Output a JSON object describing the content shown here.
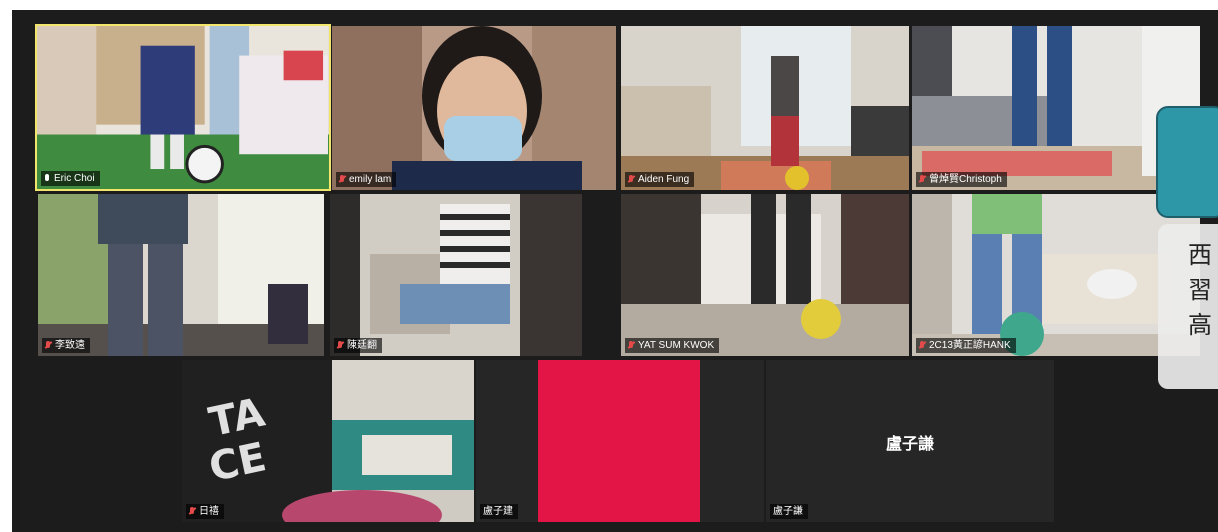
{
  "participants": [
    {
      "name": "Eric Choi",
      "mic": "on",
      "speaking": true
    },
    {
      "name": "emily lam",
      "mic": "muted"
    },
    {
      "name": "Aiden Fung",
      "mic": "muted"
    },
    {
      "name": "曾焯賢Christoph",
      "mic": "muted"
    },
    {
      "name": "李致遠",
      "mic": "muted"
    },
    {
      "name": "陳廷翻",
      "mic": "muted"
    },
    {
      "name": "YAT SUM KWOK",
      "mic": "muted"
    },
    {
      "name": "2C13黃正諺HANK",
      "mic": "muted"
    },
    {
      "name": "日禧",
      "mic": "muted"
    },
    {
      "name": "盧子建",
      "mic": "none"
    },
    {
      "name": "盧子謙",
      "mic": "none",
      "center_label": "盧子謙"
    }
  ],
  "overlay": {
    "lines": [
      "西",
      "習",
      "高"
    ],
    "accent_color": "#2d97a8"
  },
  "colors": {
    "speaker_border": "#f2e56b",
    "muted_icon": "#e34b4b",
    "background": "#1c1c1c"
  }
}
